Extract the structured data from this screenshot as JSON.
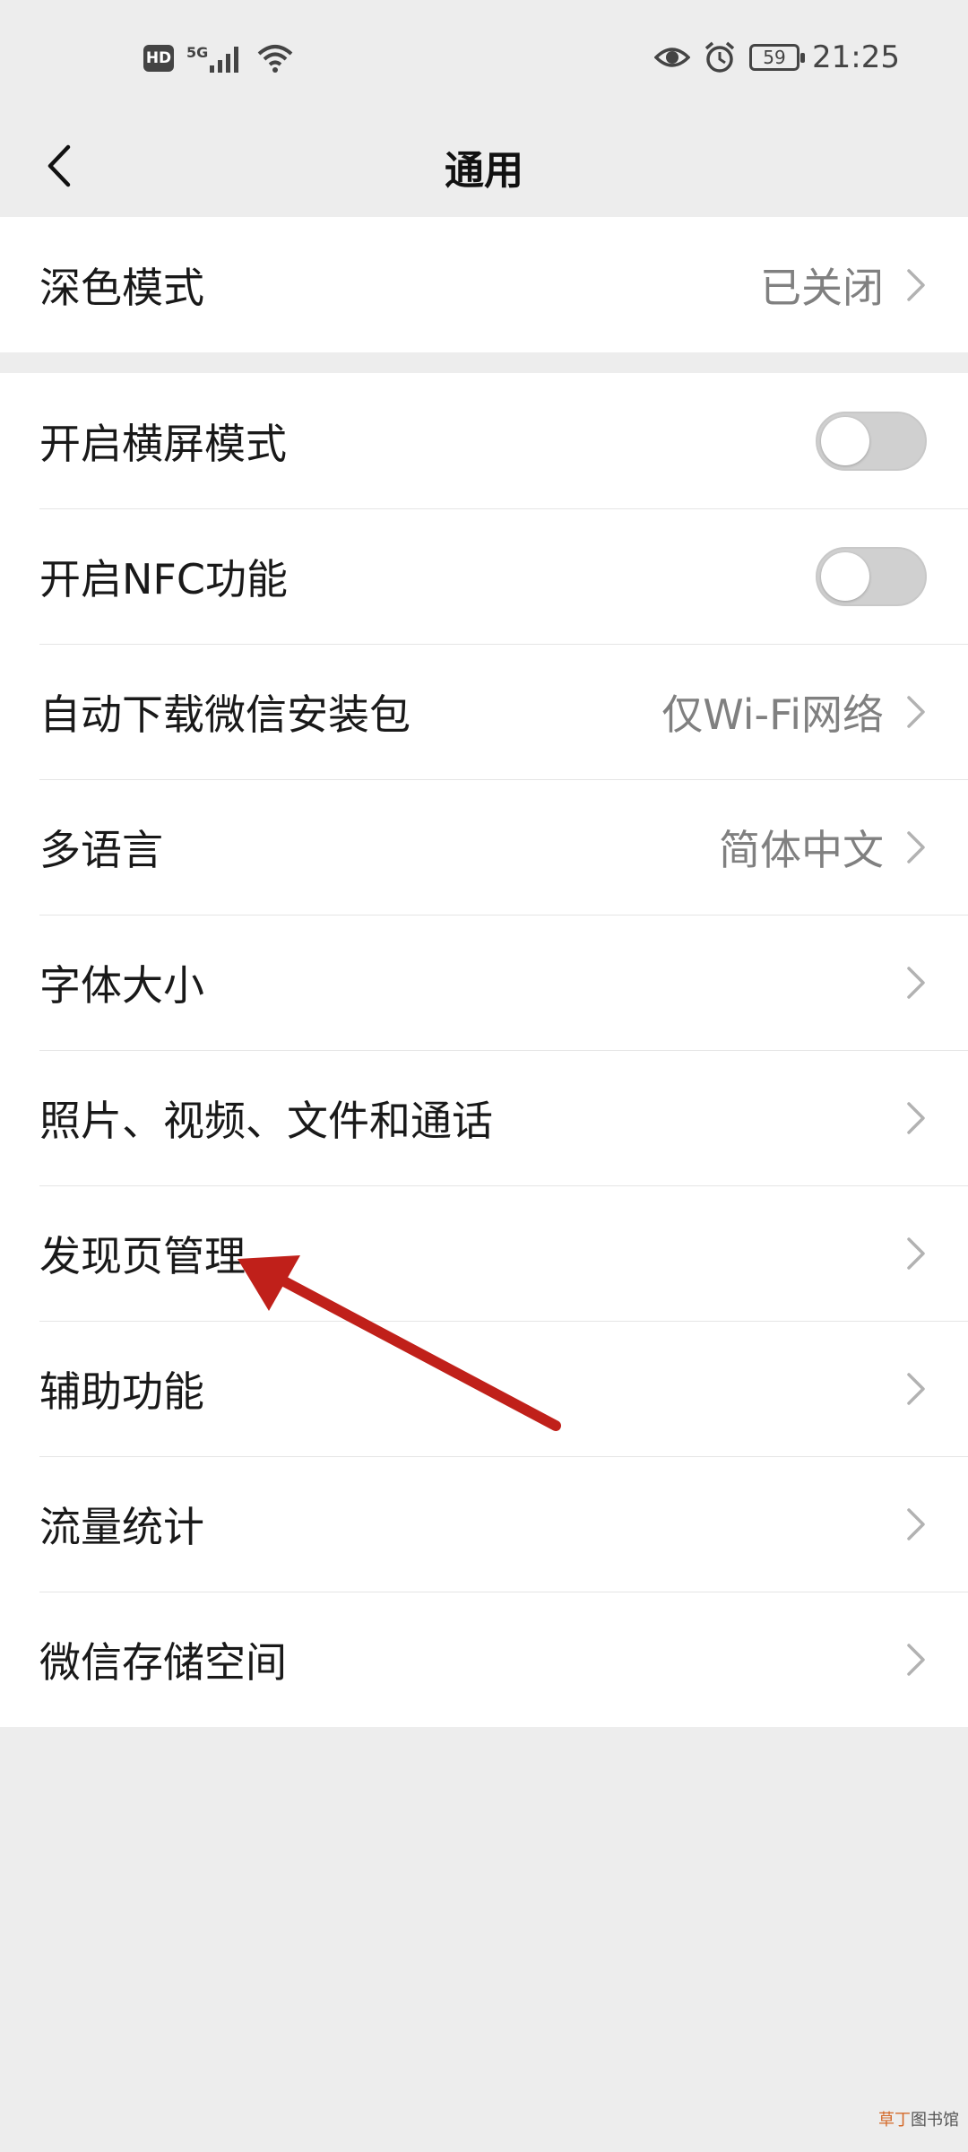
{
  "status_bar": {
    "hd": "HD",
    "network": "5G",
    "battery": "59",
    "time": "21:25"
  },
  "nav": {
    "title": "通用",
    "back_icon": "chevron-left-icon"
  },
  "groups": [
    {
      "rows": [
        {
          "label": "深色模式",
          "value": "已关闭",
          "type": "link"
        }
      ]
    },
    {
      "rows": [
        {
          "label": "开启横屏模式",
          "type": "toggle",
          "on": false
        },
        {
          "label": "开启NFC功能",
          "type": "toggle",
          "on": false
        },
        {
          "label": "自动下载微信安装包",
          "value": "仅Wi-Fi网络",
          "type": "link"
        },
        {
          "label": "多语言",
          "value": "简体中文",
          "type": "link"
        },
        {
          "label": "字体大小",
          "type": "link"
        },
        {
          "label": "照片、视频、文件和通话",
          "type": "link"
        },
        {
          "label": "发现页管理",
          "type": "link"
        },
        {
          "label": "辅助功能",
          "type": "link"
        },
        {
          "label": "流量统计",
          "type": "link"
        },
        {
          "label": "微信存储空间",
          "type": "link"
        }
      ]
    }
  ],
  "annotation": {
    "arrow_color": "#c0201a",
    "points_to": "发现页管理"
  },
  "watermark": {
    "part1": "草丁",
    "part2": "图书馆"
  },
  "colors": {
    "background": "#ededed",
    "card": "#ffffff",
    "value_text": "#808080",
    "toggle_off": "#d0d0d0"
  }
}
